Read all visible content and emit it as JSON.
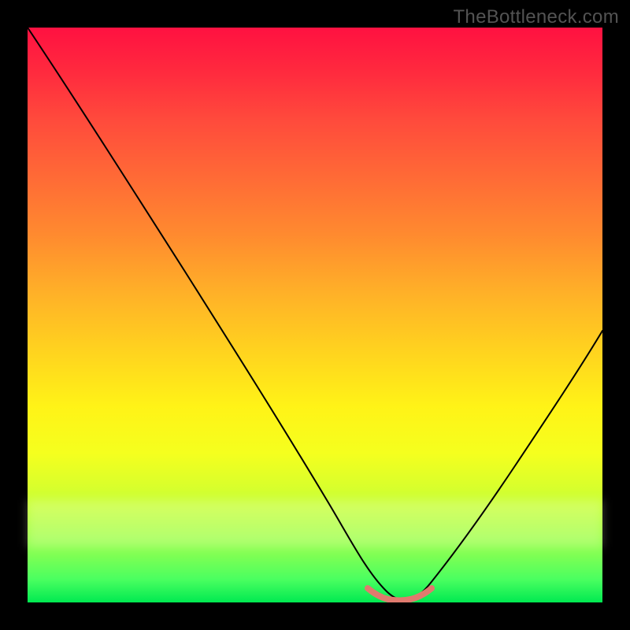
{
  "watermark": "TheBottleneck.com",
  "chart_data": {
    "type": "line",
    "title": "",
    "xlabel": "",
    "ylabel": "",
    "xlim": [
      0,
      100
    ],
    "ylim": [
      0,
      100
    ],
    "grid": false,
    "legend": false,
    "series": [
      {
        "name": "bottleneck-curve",
        "x": [
          0,
          5,
          10,
          15,
          20,
          25,
          30,
          35,
          40,
          45,
          50,
          55,
          57,
          60,
          63,
          65,
          67,
          70,
          75,
          80,
          85,
          90,
          95,
          100
        ],
        "values": [
          100,
          93,
          86,
          79,
          72,
          64,
          57,
          49,
          41,
          33,
          24,
          14,
          9,
          4,
          1,
          0.3,
          0.3,
          1,
          6,
          14,
          24,
          34,
          45,
          56
        ]
      },
      {
        "name": "optimal-range-marker",
        "x": [
          59,
          61,
          63,
          65,
          67,
          69,
          71
        ],
        "values": [
          2,
          1,
          0.5,
          0.3,
          0.5,
          1,
          2
        ]
      }
    ],
    "annotations": [
      {
        "text": "TheBottleneck.com",
        "role": "watermark",
        "position": "top-right"
      }
    ]
  }
}
